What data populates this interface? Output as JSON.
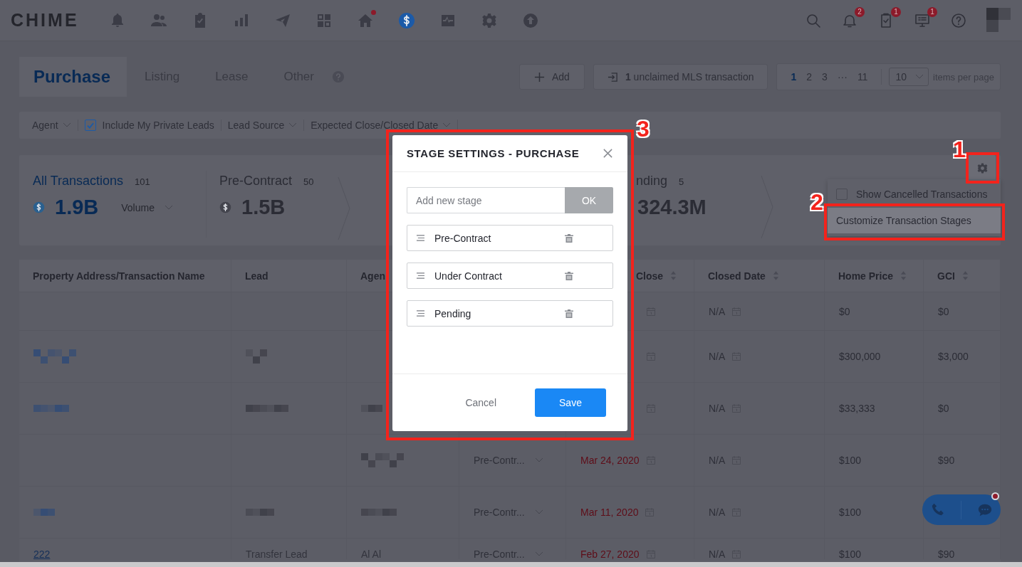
{
  "nav": {
    "logo": "CHIME",
    "apps": [
      {
        "kind": "bell-dollar",
        "selected": false,
        "dot": false
      },
      {
        "kind": "people",
        "selected": false,
        "dot": false
      },
      {
        "kind": "clipboard",
        "selected": false,
        "dot": false
      },
      {
        "kind": "chart",
        "selected": false,
        "dot": false
      },
      {
        "kind": "plane",
        "selected": false,
        "dot": false
      },
      {
        "kind": "grid",
        "selected": false,
        "dot": false
      },
      {
        "kind": "home",
        "selected": false,
        "dot": true
      },
      {
        "kind": "dollar",
        "selected": true,
        "dot": false
      },
      {
        "kind": "pulse",
        "selected": false,
        "dot": false
      },
      {
        "kind": "gear",
        "selected": false,
        "dot": false
      },
      {
        "kind": "upload",
        "selected": false,
        "dot": false
      }
    ],
    "tools": [
      {
        "kind": "search"
      },
      {
        "kind": "bell",
        "badge": "2"
      },
      {
        "kind": "task",
        "badge": "1"
      },
      {
        "kind": "monitor",
        "badge": "1"
      },
      {
        "kind": "help"
      }
    ]
  },
  "tabs": [
    {
      "label": "Purchase",
      "selected": true
    },
    {
      "label": "Listing",
      "selected": false
    },
    {
      "label": "Lease",
      "selected": false
    },
    {
      "label": "Other",
      "selected": false
    }
  ],
  "add_button": "Add",
  "mls_button": "**1** unclaimed MLS transaction",
  "pagination": {
    "pages": [
      {
        "label": "1",
        "selected": true
      },
      {
        "label": "2",
        "selected": false
      },
      {
        "label": "3",
        "selected": false
      },
      {
        "label": "···",
        "selected": false
      },
      {
        "label": "11",
        "selected": false
      }
    ],
    "per_page": "10",
    "per_page_label": "items per page"
  },
  "filters": [
    {
      "kind": "dropdown",
      "label": "Agent"
    },
    {
      "kind": "checkbox",
      "label": "Include My Private Leads",
      "checked": true
    },
    {
      "kind": "dropdown",
      "label": "Lead Source"
    },
    {
      "kind": "dropdown",
      "label": "Expected Close/Closed Date"
    }
  ],
  "stats": [
    {
      "kind": "full",
      "label": "All Transactions",
      "count": "101",
      "value": "1.9B",
      "selected": true,
      "metric": "Volume"
    },
    {
      "kind": "full",
      "label": "Pre-Contract",
      "count": "50",
      "value": "1.5B",
      "selected": false
    },
    {
      "kind": "clipped",
      "label": "nding",
      "count": "5",
      "value": "324.3M",
      "selected": false
    }
  ],
  "settings_menu": [
    {
      "kind": "checkbox",
      "label": "Show Cancelled Transactions",
      "checked": false
    },
    {
      "kind": "action",
      "label": "Customize Transaction Stages",
      "selected": true
    }
  ],
  "annotations": [
    {
      "label": "1"
    },
    {
      "label": "2"
    },
    {
      "label": "3"
    }
  ],
  "table": {
    "columns": [
      {
        "label": "Property Address/Transaction Name",
        "sortable": false
      },
      {
        "label": "Lead",
        "sortable": false
      },
      {
        "label": "Agen",
        "sortable": false
      },
      {},
      {
        "label": "Close",
        "sortable": true
      },
      {
        "label": "Closed Date",
        "sortable": true
      },
      {
        "label": "Home Price",
        "sortable": true
      },
      {
        "label": "GCI",
        "sortable": true
      }
    ],
    "rows": [
      {
        "cells": [
          {
            "kind": "blank"
          },
          {
            "kind": "blank"
          },
          {
            "kind": "blank"
          },
          {
            "kind": "blank"
          },
          {
            "kind": "date"
          },
          {
            "kind": "na",
            "text": "N/A"
          },
          {
            "kind": "text",
            "text": "$0"
          },
          {
            "kind": "text",
            "text": "$0"
          }
        ]
      },
      {
        "cells": [
          {
            "kind": "redacted-link"
          },
          {
            "kind": "redacted"
          },
          {
            "kind": "blank"
          },
          {
            "kind": "blank"
          },
          {
            "kind": "date"
          },
          {
            "kind": "na",
            "text": "N/A"
          },
          {
            "kind": "text",
            "text": "$300,000"
          },
          {
            "kind": "text",
            "text": "$3,000"
          }
        ]
      },
      {
        "cells": [
          {
            "kind": "redacted-link"
          },
          {
            "kind": "redacted"
          },
          {
            "kind": "redacted"
          },
          {
            "kind": "blank"
          },
          {
            "kind": "date"
          },
          {
            "kind": "na",
            "text": "N/A"
          },
          {
            "kind": "text",
            "text": "$33,333"
          },
          {
            "kind": "text",
            "text": "$0"
          }
        ]
      },
      {
        "cells": [
          {
            "kind": "blank"
          },
          {
            "kind": "blank"
          },
          {
            "kind": "redacted"
          },
          {
            "kind": "stage",
            "text": "Pre-Contr..."
          },
          {
            "kind": "date",
            "text": "Mar 24, 2020"
          },
          {
            "kind": "na",
            "text": "N/A"
          },
          {
            "kind": "text",
            "text": "$100"
          },
          {
            "kind": "text",
            "text": "$90"
          }
        ]
      },
      {
        "cells": [
          {
            "kind": "redacted-link"
          },
          {
            "kind": "redacted"
          },
          {
            "kind": "redacted"
          },
          {
            "kind": "stage",
            "text": "Pre-Contr..."
          },
          {
            "kind": "date",
            "text": "Mar 11, 2020"
          },
          {
            "kind": "na",
            "text": "N/A"
          },
          {
            "kind": "text",
            "text": "$100"
          },
          {
            "kind": "blank"
          }
        ]
      },
      {
        "cells": [
          {
            "kind": "faint-link",
            "text": "222"
          },
          {
            "kind": "faint",
            "text": "Transfer Lead"
          },
          {
            "kind": "faint",
            "text": "Al Al"
          },
          {
            "kind": "stage",
            "text": "Pre-Contr..."
          },
          {
            "kind": "date",
            "text": "Feb 27, 2020"
          },
          {
            "kind": "na",
            "text": "N/A"
          },
          {
            "kind": "text",
            "text": "$100"
          },
          {
            "kind": "text",
            "text": "$90"
          }
        ]
      }
    ]
  },
  "modal": {
    "title": "STAGE SETTINGS - PURCHASE",
    "input": {
      "placeholder": "Add new stage"
    },
    "ok": "OK",
    "stages": [
      {
        "name": "Pre-Contract"
      },
      {
        "name": "Under Contract"
      },
      {
        "name": "Pending"
      }
    ],
    "cancel": "Cancel",
    "save": "Save"
  },
  "contact_widget": {
    "dot": true
  }
}
